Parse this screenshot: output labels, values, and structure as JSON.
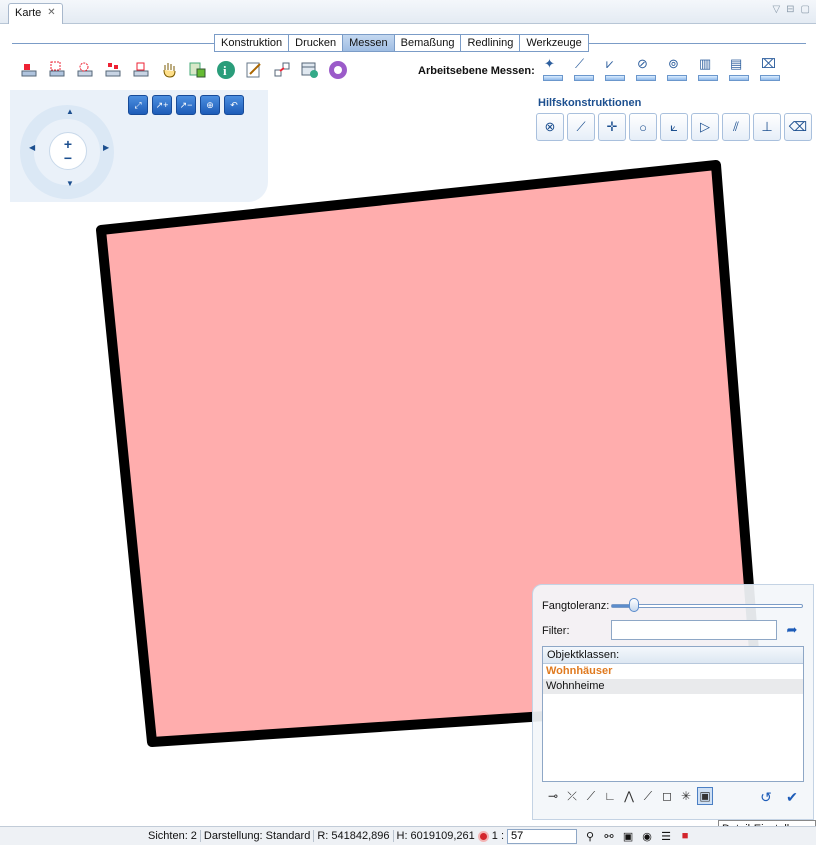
{
  "window": {
    "tab_title": "Karte",
    "close_glyph": "✕"
  },
  "ribbon": {
    "tabs": [
      {
        "label": "Konstruktion"
      },
      {
        "label": "Drucken"
      },
      {
        "label": "Messen",
        "active": true
      },
      {
        "label": "Bemaßung"
      },
      {
        "label": "Redlining"
      },
      {
        "label": "Werkzeuge"
      }
    ]
  },
  "toolbar": {
    "icons": [
      "layer-select-icon",
      "select-object-icon",
      "select-area-icon",
      "select-multi-icon",
      "deselect-icon",
      "pan-hand-icon",
      "object-info-icon",
      "info-icon",
      "edit-document-icon",
      "export-icon",
      "table-icon",
      "network-icon"
    ],
    "arbeitsebene_label": "Arbeitsebene Messen:",
    "mess_icons": [
      "measure-point-icon",
      "measure-line-icon",
      "measure-polyline-icon",
      "measure-circle-icon",
      "measure-ellipse-icon",
      "measure-building-icon",
      "measure-object-icon",
      "measure-clear-icon"
    ]
  },
  "navigation": {
    "zoom_in": "+",
    "zoom_out": "−",
    "zoom_buttons": [
      "zoom-extent-icon",
      "zoom-in-icon",
      "zoom-out-icon",
      "zoom-window-icon",
      "zoom-previous-icon"
    ]
  },
  "hilfskonstruktionen": {
    "label": "Hilfskonstruktionen",
    "tools": [
      "intersection-icon",
      "line-icon",
      "point-icon",
      "circle-icon",
      "angle-line-icon",
      "triangle-icon",
      "parallel-icon",
      "perpendicular-icon",
      "clear-construction-icon"
    ]
  },
  "map": {
    "polygon_fill": "#ffadad",
    "polygon_stroke": "#000000"
  },
  "snap_panel": {
    "fangtoleranz_label": "Fangtoleranz:",
    "fangtoleranz_value": 0.12,
    "filter_label": "Filter:",
    "filter_value": "",
    "objektklassen_header": "Objektklassen:",
    "objektklassen": [
      {
        "label": "Wohnhäuser",
        "active": true
      },
      {
        "label": "Wohnheime",
        "selected": true
      }
    ],
    "snap_tools": [
      "snap-endpoint-icon",
      "snap-intersection-icon",
      "snap-tangent-icon",
      "snap-perpendicular-icon",
      "snap-vertex-icon",
      "snap-line-icon",
      "snap-square-icon",
      "snap-magic-icon",
      "snap-detail-icon"
    ],
    "tooltip": "Detail-Einstellungen"
  },
  "status": {
    "sichten": "Sichten: 2",
    "darstellung": "Darstellung: Standard",
    "r": "R: 541842,896",
    "h": "H: 6019109,261",
    "scale_prefix": "1 :",
    "scale_value": "57"
  },
  "colors": {
    "accent": "#1d5cb8",
    "active_class": "#e07a1f",
    "polygon_fill": "#ffadad"
  }
}
